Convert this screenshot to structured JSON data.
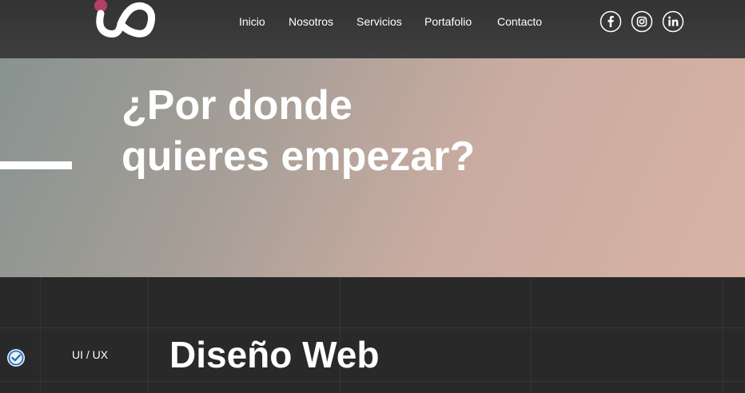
{
  "header": {
    "logo_icon": "brand-logo-icon",
    "nav": [
      {
        "label": "Inicio"
      },
      {
        "label": "Nosotros"
      },
      {
        "label": "Servicios"
      },
      {
        "label": "Portafolio"
      },
      {
        "label": "Contacto"
      }
    ],
    "social": [
      {
        "icon": "facebook-icon"
      },
      {
        "icon": "instagram-icon"
      },
      {
        "icon": "linkedin-icon"
      }
    ]
  },
  "hero": {
    "title_line1": "¿Por donde",
    "title_line2": "quieres empezar?"
  },
  "services": {
    "check_icon": "check-badge-icon",
    "category": "UI / UX",
    "title": "Diseño Web"
  },
  "colors": {
    "header_bg": "#363636",
    "hero_gradient_start": "#889391",
    "hero_gradient_end": "#d8b2a4",
    "logo_accent": "#b3406a",
    "section_bg": "#292929",
    "text": "#ffffff"
  }
}
